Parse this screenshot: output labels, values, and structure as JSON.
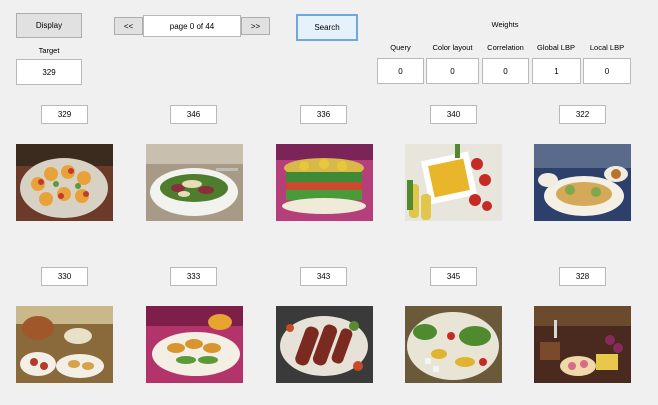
{
  "controls": {
    "display_label": "Display",
    "target_label": "Target",
    "target_value": "329",
    "prev_label": "<<",
    "next_label": ">>",
    "page_text": "page 0 of 44",
    "search_label": "Search"
  },
  "weights": {
    "title": "Weights",
    "items": [
      {
        "label": "Query",
        "value": "0"
      },
      {
        "label": "Color layout",
        "value": "0"
      },
      {
        "label": "Correlation",
        "value": "0"
      },
      {
        "label": "Global LBP",
        "value": "1"
      },
      {
        "label": "Local LBP",
        "value": "0"
      }
    ]
  },
  "results": [
    {
      "id": "329",
      "scene": "food-photo-skewers-on-plate"
    },
    {
      "id": "346",
      "scene": "food-photo-salad-plate"
    },
    {
      "id": "336",
      "scene": "food-photo-layered-dish"
    },
    {
      "id": "340",
      "scene": "food-photo-corn-and-tomatoes"
    },
    {
      "id": "322",
      "scene": "food-photo-table-setting"
    },
    {
      "id": "330",
      "scene": "food-photo-roast-buffet"
    },
    {
      "id": "333",
      "scene": "food-photo-grilled-platter"
    },
    {
      "id": "343",
      "scene": "food-photo-sausages-grill"
    },
    {
      "id": "345",
      "scene": "food-photo-vegetable-platter"
    },
    {
      "id": "328",
      "scene": "food-photo-dessert-table"
    }
  ],
  "colors": {
    "window_bg": "#f0f0f0",
    "button_bg": "#e1e1e1",
    "focus_border": "#6fa8dc"
  }
}
